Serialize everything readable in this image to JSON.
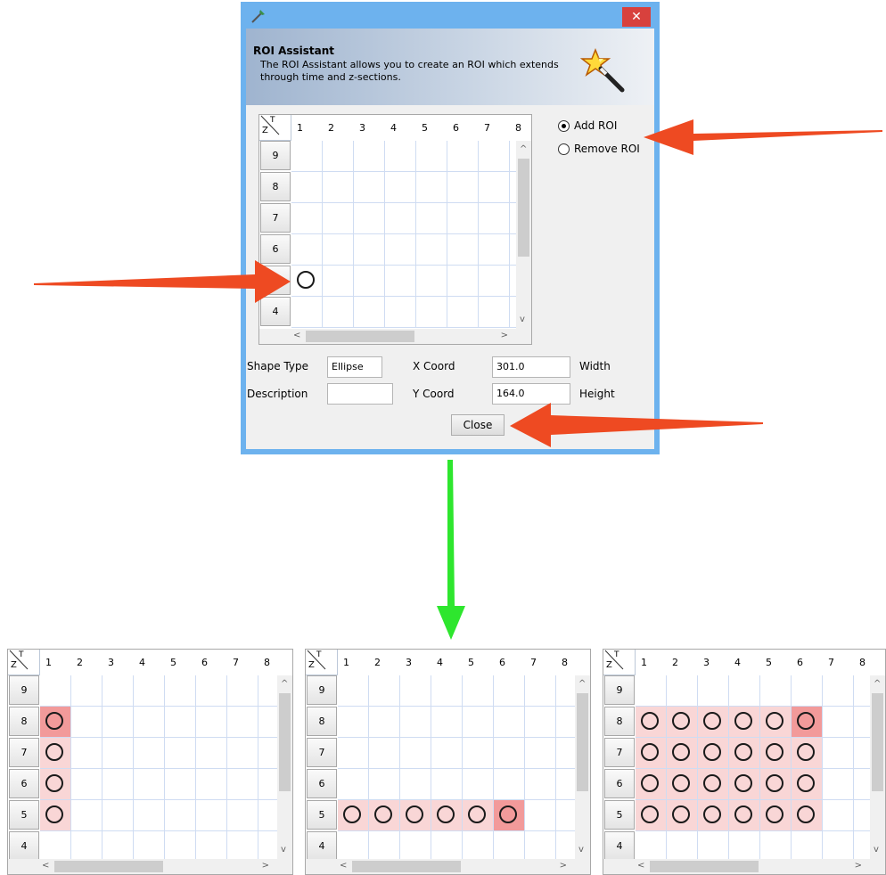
{
  "dialog": {
    "header_title": "ROI Assistant",
    "header_desc": "The ROI Assistant allows you to create an ROI which extends through time and z-sections.",
    "close_glyph": "✕",
    "app_icon": "brush-icon",
    "header_icon": "magic-wand-icon"
  },
  "grid": {
    "corner_z": "Z",
    "corner_t": "T",
    "columns": [
      "1",
      "2",
      "3",
      "4",
      "5",
      "6",
      "7",
      "8"
    ],
    "rows": [
      "9",
      "8",
      "7",
      "6",
      "5",
      "4"
    ],
    "scroll_left": "<",
    "scroll_right": ">",
    "scroll_up": "^",
    "scroll_down": "v"
  },
  "options": {
    "add_roi": "Add ROI",
    "remove_roi": "Remove ROI",
    "selected": "add_roi"
  },
  "form": {
    "shape_type_label": "Shape Type",
    "shape_type_value": "Ellipse",
    "description_label": "Description",
    "description_value": "",
    "x_label": "X Coord",
    "x_value": "301.0",
    "y_label": "Y Coord",
    "y_value": "164.0",
    "width_label": "Width",
    "height_label": "Height",
    "close_button": "Close"
  },
  "examples": [
    {
      "selected": [
        [
          1,
          8
        ],
        [
          1,
          7
        ],
        [
          1,
          6
        ],
        [
          1,
          5
        ]
      ],
      "current": [
        1,
        8
      ]
    },
    {
      "selected": [
        [
          1,
          5
        ],
        [
          2,
          5
        ],
        [
          3,
          5
        ],
        [
          4,
          5
        ],
        [
          5,
          5
        ],
        [
          6,
          5
        ]
      ],
      "current": [
        6,
        5
      ]
    },
    {
      "selected": [
        [
          1,
          8
        ],
        [
          2,
          8
        ],
        [
          3,
          8
        ],
        [
          4,
          8
        ],
        [
          5,
          8
        ],
        [
          6,
          8
        ],
        [
          1,
          7
        ],
        [
          2,
          7
        ],
        [
          3,
          7
        ],
        [
          4,
          7
        ],
        [
          5,
          7
        ],
        [
          6,
          7
        ],
        [
          1,
          6
        ],
        [
          2,
          6
        ],
        [
          3,
          6
        ],
        [
          4,
          6
        ],
        [
          5,
          6
        ],
        [
          6,
          6
        ],
        [
          1,
          5
        ],
        [
          2,
          5
        ],
        [
          3,
          5
        ],
        [
          4,
          5
        ],
        [
          5,
          5
        ],
        [
          6,
          5
        ]
      ],
      "current": [
        6,
        8
      ]
    }
  ],
  "dialog_grid_rois": [
    [
      1,
      5
    ]
  ],
  "annotation_colors": {
    "red_arrow": "#ee4a22",
    "green_arrow": "#2ee62e"
  }
}
